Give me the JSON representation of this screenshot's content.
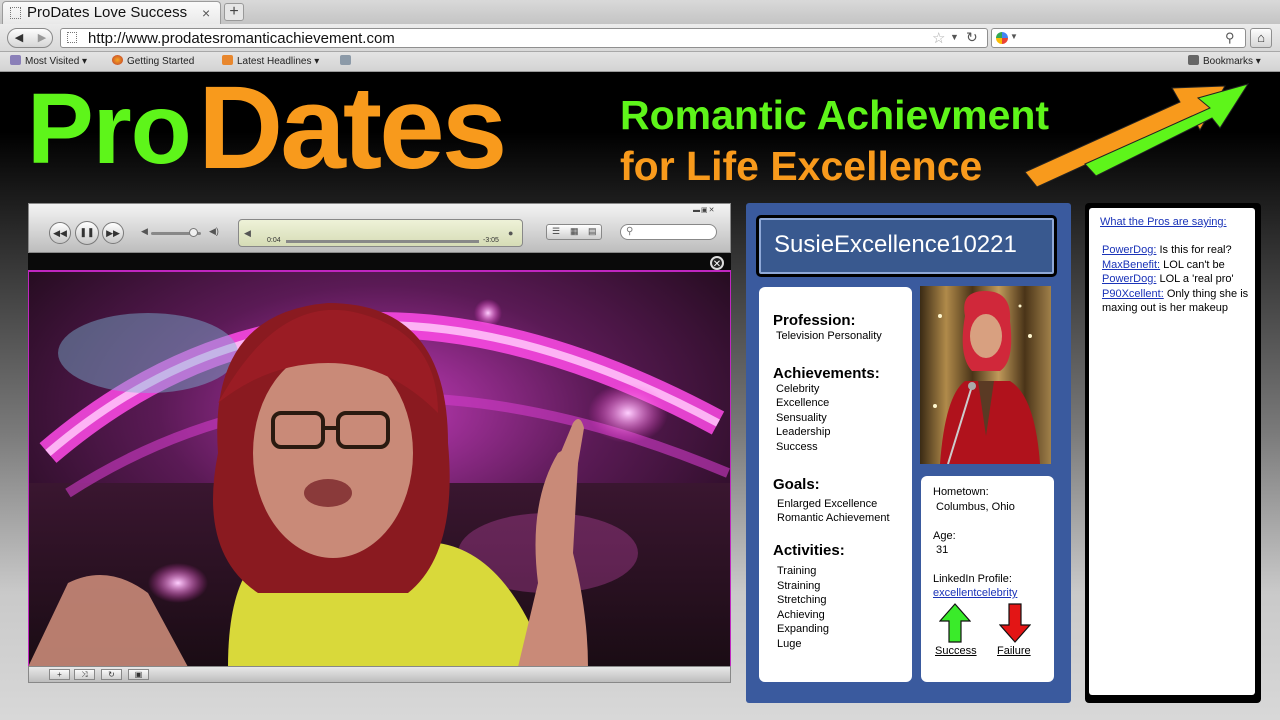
{
  "browser": {
    "tab_title": "ProDates Love Success",
    "tab_close": "×",
    "new_tab": "+",
    "url": "http://www.prodatesromanticachievement.com",
    "bookmarks_left": [
      "Most Visited ▾",
      "Getting Started",
      "Latest Headlines ▾"
    ],
    "bookmarks_right": "Bookmarks ▾"
  },
  "header": {
    "logo_pro": "Pro",
    "logo_dates": "Dates",
    "tagline_line1": "Romantic Achievment",
    "tagline_line2": "for Life Excellence",
    "arrow_colors": [
      "#f89a1c",
      "#5ef51a"
    ]
  },
  "player": {
    "elapsed": "0:04",
    "remaining": "-3:05",
    "volume": 0.85,
    "progress": 0.02
  },
  "profile": {
    "username": "SusieExcellence10221",
    "profession_heading": "Profession:",
    "profession": "Television Personality",
    "achievements_heading": "Achievements:",
    "achievements": [
      "Celebrity",
      "Excellence",
      "Sensuality",
      "Leadership",
      "Success"
    ],
    "goals_heading": "Goals:",
    "goals": [
      "Enlarged Excellence",
      "Romantic Achievement"
    ],
    "activities_heading": "Activities:",
    "activities": [
      "Training",
      "Straining",
      "Stretching",
      "Achieving",
      "Expanding",
      "Luge"
    ],
    "hometown_label": "Hometown:",
    "hometown": "Columbus, Ohio",
    "age_label": "Age:",
    "age": "31",
    "linkedin_label": "LinkedIn Profile:",
    "linkedin": "excellentcelebrity",
    "success_label": "Success",
    "failure_label": "Failure"
  },
  "comments": {
    "title": "What the Pros are saying:",
    "items": [
      {
        "user": "PowerDog:",
        "text": " Is this for real?"
      },
      {
        "user": "MaxBenefit:",
        "text": " LOL can't be"
      },
      {
        "user": "PowerDog:",
        "text": " LOL a 'real pro'"
      },
      {
        "user": "P90Xcellent:",
        "text": " Only thing she is maxing out is her makeup"
      }
    ]
  },
  "colors": {
    "green": "#5ef51a",
    "orange": "#f89a1c",
    "profile_blue": "#3a5a9e",
    "link_blue": "#1a33b8"
  }
}
